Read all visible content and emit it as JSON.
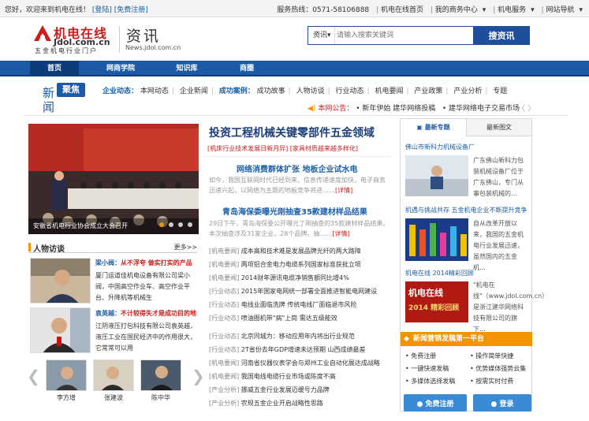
{
  "topbar": {
    "welcome": "您好，欢迎来到机电在线！",
    "register": "[登陆]",
    "free_register": "[免费注册]",
    "hotline": "服务热线：0571-58106888",
    "home": "机电在线首页",
    "my_business": "我的商务中心",
    "service": "机电服务",
    "site_nav": "网站导航"
  },
  "header": {
    "logo_cn": "机电在线",
    "logo_en": "Jdol.com.cn",
    "logo_sub": "五金机电行业门户",
    "section_title": "资讯",
    "section_url": "News.jdol.com.cn"
  },
  "search": {
    "select_label": "资讯",
    "placeholder": "请输入搜索关键词",
    "button": "搜资讯"
  },
  "nav": [
    "首页",
    "网商学院",
    "知识库",
    "商圈"
  ],
  "subnav": {
    "logo_a": "新",
    "logo_b": "闻",
    "logo_badge": "聚焦",
    "industry_label": "企业动态：",
    "industry_items": [
      "本网动态",
      "企业新闻"
    ],
    "case_label": "成功案例：",
    "case_items": [
      "成功故事",
      "人物访谈",
      "行业动态",
      "机电要闻",
      "产业政策",
      "产业分析",
      "专题"
    ],
    "notice_label": "本网公告：",
    "notice_items": [
      "新年伊始 建华网络投稿",
      "建华网络电子交易市场"
    ],
    "arrows": "〈 〉"
  },
  "photo": {
    "caption": "安徽省机电行业协会成立大会召开"
  },
  "headline": {
    "main": "投资工程机械关键零部件五金领域",
    "tags": "[机床行业技术发展日新月异] [家具材质越来越多样化]",
    "stories": [
      {
        "title": "网络消费群体扩张 地板企业试水电",
        "summary": "如今，我国互联网时代已经到来，信息传递速度加快，电子商务迅速兴起，以网络为主题的地板竞争将进……",
        "more": "[详情]"
      },
      {
        "title": "青岛海保委曝光刚抽查35款建材样品结果",
        "summary": "29日下午，青岛海保委公开曝光了刚抽查的35款建材样品结果。本次抽查涉及31家企业，28个品牌。抽……",
        "more": "[详情]"
      }
    ]
  },
  "people": {
    "title": "人物访谈",
    "more": "更多>>",
    "items": [
      {
        "name": "梁小阀：",
        "quote": "从不浮夸 做实打实的产品",
        "text": "厦门运道佳机电设备有限公司梁小阀，中国高空作业车、高空作业平台、升降机等机械生"
      },
      {
        "name": "袁英越：",
        "quote": "不计较得失才是成功目的地",
        "text": "江阴液压打包科技有限公司袁英越，液压工业在国民经济中的作用很大，它常常可以用"
      }
    ],
    "gallery": [
      "李方增",
      "张建波",
      "陈中华"
    ]
  },
  "news_list": [
    {
      "cat": "[机电要闻]",
      "title": "成本高和技术难是发展品牌光纤的两大路障"
    },
    {
      "cat": "[机电要闻]",
      "title": "两项铝合金电力电缆系列国家标准获批立项"
    },
    {
      "cat": "[机电要闻]",
      "title": "2014财年源讯电缆净销售额同比增4%"
    },
    {
      "cat": "[行业动态]",
      "title": "2015年国家电网统一部署全面推进智能电网建设"
    },
    {
      "cat": "[行业动态]",
      "title": "电线业面临洗牌 传统电线厂面临退市风险"
    },
    {
      "cat": "[行业动态]",
      "title": "喷油圈机带\"病\"上岗 需达五级能效"
    },
    {
      "cat": "[行业动态]",
      "title": "北京同城为：移动应用年内将出行业规范"
    },
    {
      "cat": "[行业动态]",
      "title": "2T省份去年GDP增速未达预期 山西成绩最差"
    },
    {
      "cat": "[机电要闻]",
      "title": "河南省仪器仪表学会与郑州工业自动化展达成战略"
    },
    {
      "cat": "[机电要闻]",
      "title": "我国电线电缆行业市场或陈度不高"
    },
    {
      "cat": "[产业分析]",
      "title": "挪威五金行业发展迈缓号力品牌"
    },
    {
      "cat": "[产业分析]",
      "title": "农规五金企业开启战略性思路"
    }
  ],
  "rightcol": {
    "tab_active": "最新专题",
    "tab_other": "最新图文",
    "items": [
      {
        "title": "佛山市新科力机械设备厂",
        "text": "广东佛山新科力包装机械设备厂位于广东佛山，专门从事包装机械的…"
      },
      {
        "title": "机遇与挑战共存 五金机电企业不断提升竞争",
        "text": "自从改革开放以来，我国的五金机电行业发展迅速，虽然国内的五金机…"
      },
      {
        "title": "机电在线 2014精彩回顾",
        "text": "\"机电在线\"（www.jdol.com.cn）是浙江建华网络科技有限公司的旗下…"
      }
    ],
    "banner_a": "机电在线",
    "banner_b": "2014 精彩回顾"
  },
  "promo": {
    "title": "新闻营销发稿第一平台",
    "items": [
      "免费注册",
      "操作简单快捷",
      "一键快速发稿",
      "优势媒体强势云集",
      "多媒体选择发稿",
      "按需实时付费"
    ],
    "register": "免费注册",
    "login": "登录"
  },
  "colors": {
    "brand_blue": "#1c5aa8",
    "brand_red": "#cc1d1d",
    "accent_orange": "#f29400"
  }
}
